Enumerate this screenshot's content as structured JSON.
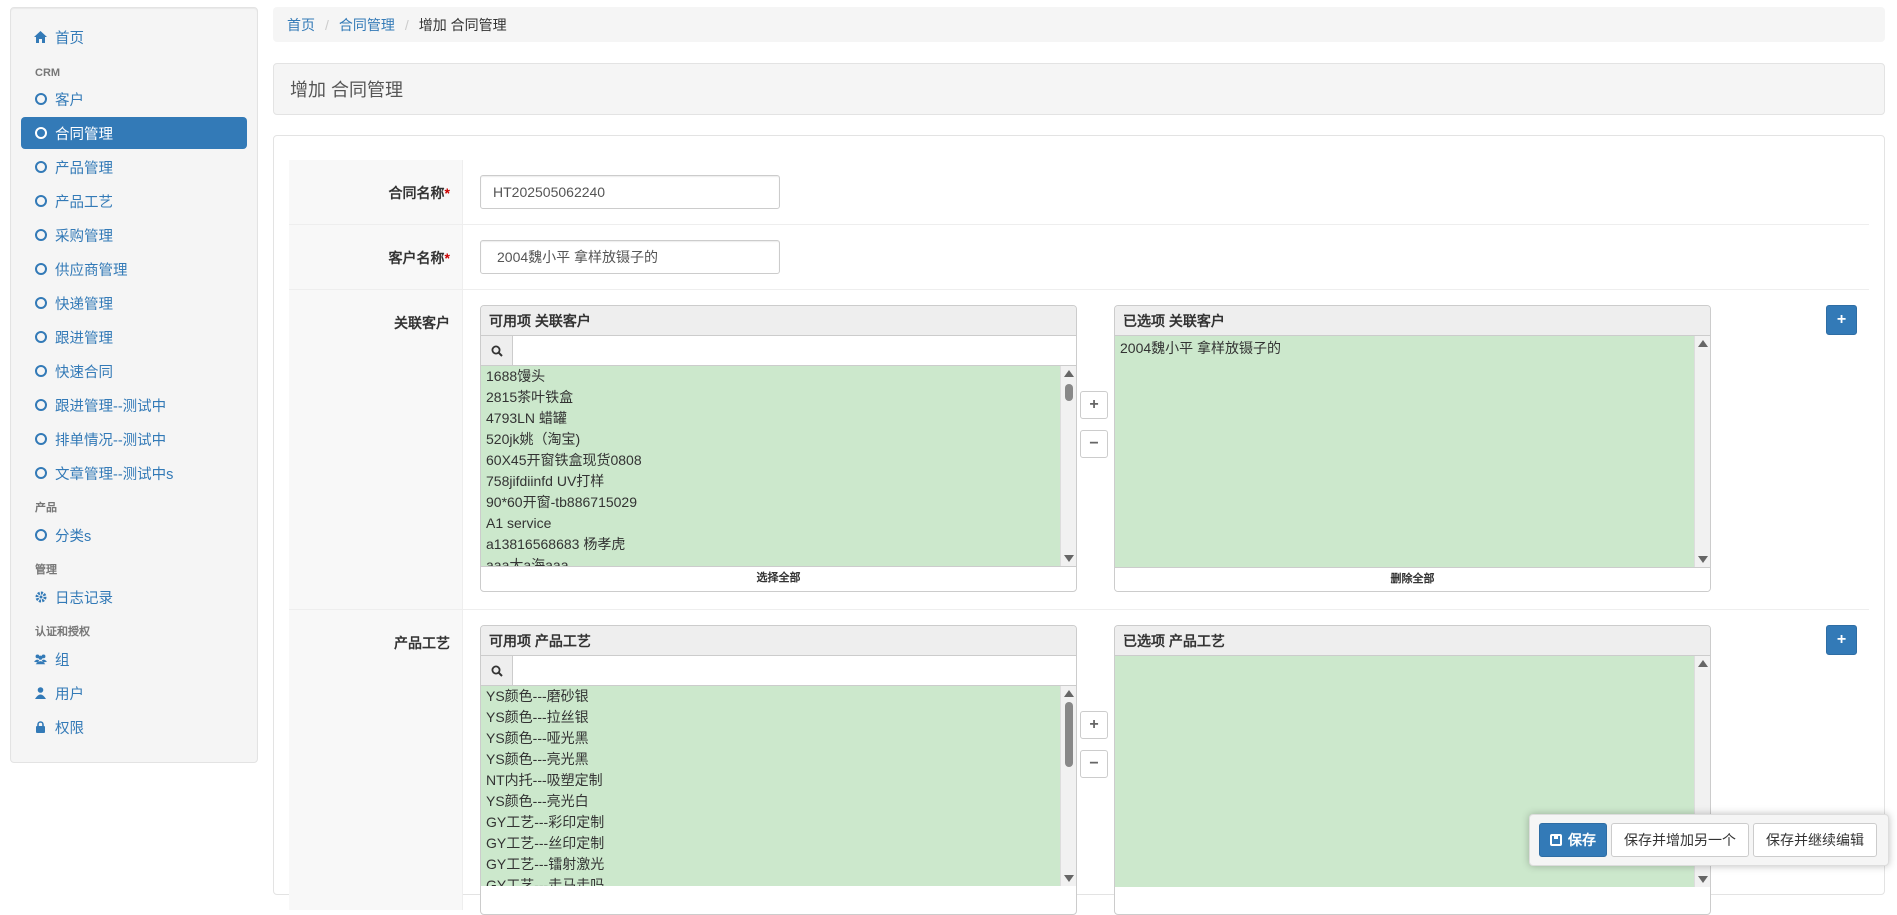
{
  "sidebar": {
    "home": "首页",
    "sections": [
      {
        "header": "CRM"
      },
      {
        "header": "产品"
      },
      {
        "header": "管理"
      },
      {
        "header": "认证和授权"
      }
    ],
    "crm_items": [
      "客户",
      "合同管理",
      "产品管理",
      "产品工艺",
      "采购管理",
      "供应商管理",
      "快递管理",
      "跟进管理",
      "快速合同",
      "跟进管理--测试中",
      "排单情况--测试中",
      "文章管理--测试中s"
    ],
    "product_items": [
      "分类s"
    ],
    "admin_items": [
      "日志记录"
    ],
    "auth_items": [
      "组",
      "用户",
      "权限"
    ],
    "active_item": "合同管理"
  },
  "breadcrumb": {
    "home": "首页",
    "section": "合同管理",
    "current": "增加 合同管理"
  },
  "page_title": "增加 合同管理",
  "form": {
    "contract_name": {
      "label": "合同名称",
      "value": "HT202505062240"
    },
    "customer_name": {
      "label": "客户名称",
      "value": "2004魏小平 拿样放镊子的"
    },
    "related_customers": {
      "label": "关联客户",
      "available_title": "可用项 关联客户",
      "chosen_title": "已选项 关联客户",
      "available": [
        "1688馒头",
        "2815茶叶铁盒",
        "4793LN 蜡罐",
        "520jk姚（淘宝)",
        "60X45开窗铁盒现货0808",
        "758jifdiinfd UV打样",
        "90*60开窗-tb886715029",
        "A1 service",
        "a13816568683 杨孝虎",
        "aaa大a海aaa"
      ],
      "chosen": [
        "2004魏小平 拿样放镊子的"
      ],
      "choose_all": "选择全部",
      "remove_all": "删除全部"
    },
    "product_process": {
      "label": "产品工艺",
      "available_title": "可用项 产品工艺",
      "chosen_title": "已选项 产品工艺",
      "available": [
        "YS颜色---磨砂银",
        "YS颜色---拉丝银",
        "YS颜色---哑光黑",
        "YS颜色---亮光黑",
        "NT内托---吸塑定制",
        "YS颜色---亮光白",
        "GY工艺---彩印定制",
        "GY工艺---丝印定制",
        "GY工艺---镭射激光",
        "GY工艺---走马走吗"
      ],
      "chosen": []
    },
    "move_add": "+",
    "move_remove": "−",
    "add_related": "+"
  },
  "actions": {
    "save": "保存",
    "save_add_another": "保存并增加另一个",
    "save_continue": "保存并继续编辑"
  },
  "colors": {
    "primary": "#337ab7",
    "option_bg": "#cce8cc",
    "required": "#cc0000"
  }
}
